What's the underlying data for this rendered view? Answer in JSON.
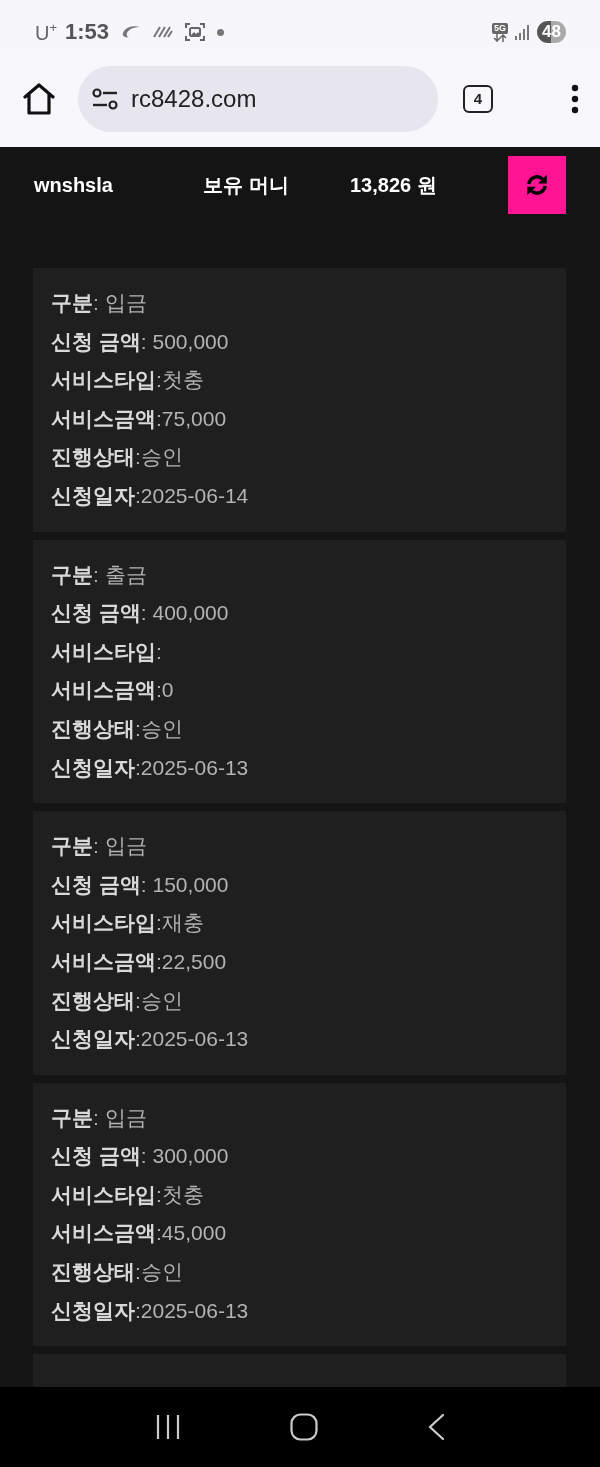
{
  "status_bar": {
    "carrier": "U$^{+}$",
    "time": "1:53",
    "network": "5G",
    "battery": "48"
  },
  "browser": {
    "url": "rc8428.com",
    "tab_count": "4"
  },
  "account": {
    "username": "wnshsla",
    "balance_label": "보유 머니",
    "balance": "13,826 원"
  },
  "records": [
    {
      "lines": [
        "**구분**: 입금",
        "**신청 금액**: 500,000",
        "**서비스타입**:첫충",
        "**서비스금액**:75,000",
        "**진행상태**:승인",
        "**신청일자**:2025-06-14"
      ]
    },
    {
      "lines": [
        "**구분**: 출금",
        "**신청 금액**: 400,000",
        "**서비스타입**:",
        "**서비스금액**:0",
        "**진행상태**:승인",
        "**신청일자**:2025-06-13"
      ]
    },
    {
      "lines": [
        "**구분**: 입금",
        "**신청 금액**: 150,000",
        "**서비스타입**:재충",
        "**서비스금액**:22,500",
        "**진행상태**:승인",
        "**신청일자**:2025-06-13"
      ]
    },
    {
      "lines": [
        "**구분**: 입금",
        "**신청 금액**: 300,000",
        "**서비스타입**:첫충",
        "**서비스금액**:45,000",
        "**진행상태**:승인",
        "**신청일자**:2025-06-13"
      ]
    }
  ]
}
